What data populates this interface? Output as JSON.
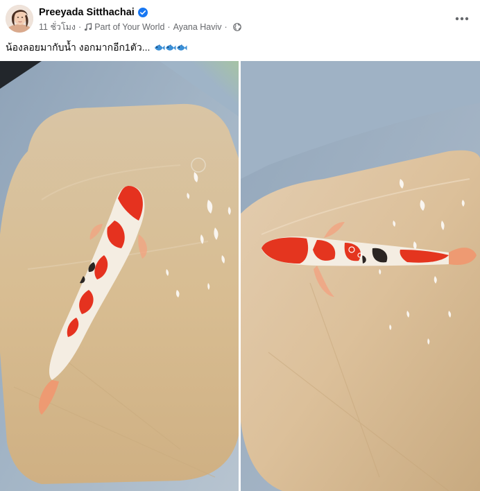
{
  "post": {
    "author_name": "Preeyada Sitthachai",
    "verified": true,
    "timestamp": "11 ชั่วโมง",
    "music_song": "Part of Your World",
    "music_artist": "Ayana Haviv",
    "audience_icon": "globe-icon",
    "caption": "น้องลอยมากับน้ำ งอกมากอีก1ตัว...",
    "caption_emoji": "fish-icon x3",
    "photos": [
      {
        "description_icon": "koi-fish-photo"
      },
      {
        "description_icon": "koi-fish-photo"
      }
    ]
  },
  "colors": {
    "verified_blue": "#1877f2",
    "meta_gray": "#65676b",
    "text": "#050505",
    "fish_emoji_blue": "#3b8fd6"
  },
  "icons": {
    "more": "more-options-icon",
    "music": "music-note-icon",
    "audience": "globe-icon",
    "verified": "verified-badge-icon"
  }
}
